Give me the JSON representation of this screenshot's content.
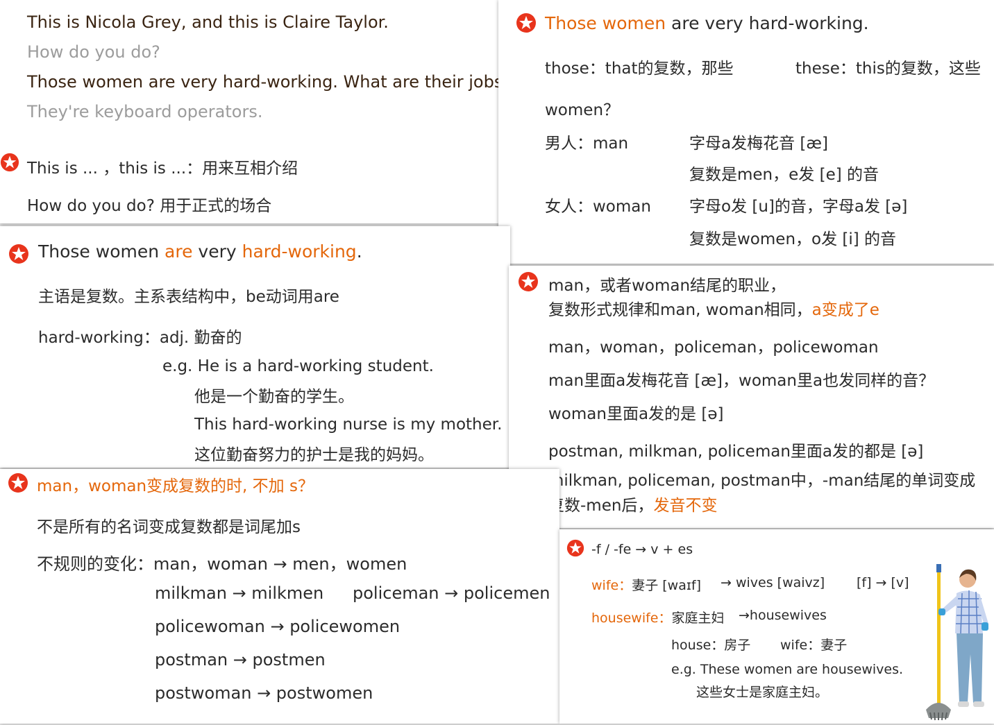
{
  "colors": {
    "accent": "#e4670b",
    "star": "#e8341c",
    "dark_text": "#3a2412",
    "muted_text": "#9c9c9c"
  },
  "p1": {
    "line1": "This is Nicola Grey, and this is Claire Taylor.",
    "line2": "How do you do?",
    "line3": "Those women are very hard-working. What are their jobs?",
    "line4": "They're keyboard operators.",
    "note1": "This is ... ，this is ...：用来互相介绍",
    "note2": "How do you do? 用于正式的场合"
  },
  "p2": {
    "head_a": "Those women",
    "head_b": " are very hard-working.",
    "those": "those：that的复数，那些",
    "these": "these：this的复数，这些",
    "women_q": "women？",
    "man_label": "男人：man",
    "man_desc1": "字母a发梅花音 [æ]",
    "man_desc2": "复数是men，e发 [e] 的音",
    "woman_label": "女人：woman",
    "woman_desc1": "字母o发 [u]的音，字母a发 [ə]",
    "woman_desc2": "复数是women，o发 [i] 的音"
  },
  "p3": {
    "h1": "Those women ",
    "h2": "are",
    " h3": "",
    "h3a": " very ",
    "h4": "hard-working",
    "h5": ".",
    "l1": "主语是复数。主系表结构中，be动词用are",
    "l2": "hard-working：adj. 勤奋的",
    "eg1": "e.g. He is a hard-working student.",
    "eg1_cn": "他是一个勤奋的学生。",
    "eg2": "This hard-working nurse is my mother.",
    "eg2_cn": "这位勤奋努力的护士是我的妈妈。"
  },
  "p4": {
    "h1": "man，或者woman结尾的职业，",
    "h2a": "复数形式规律和man, woman相同，",
    "h2b": "a变成了e",
    "l1": "man，woman，policeman，policewoman",
    "l2": "man里面a发梅花音 [æ]，woman里a也发同样的音？",
    "l3": "woman里面a发的是 [ə]",
    "l4": "postman, milkman, policeman里面a发的都是 [ə]",
    "l5": "milkman, policeman, postman中，-man结尾的单词变成",
    "l6a": "复数-men后，",
    "l6b": "发音不变"
  },
  "p5": {
    "h": "man，woman变成复数的时, 不加 s？",
    "l1": "不是所有的名词变成复数都是词尾加s",
    "l2": "不规则的变化：man，woman → men，women",
    "l3a": "milkman → milkmen",
    "l3b": "policeman → policemen",
    "l4": "policewoman → policewomen",
    "l5": "postman → postmen",
    "l6": "postwoman → postwomen"
  },
  "p6": {
    "h": "-f / -fe → v + es",
    "wife_a": "wife：",
    "wife_b": "妻子 [waɪf]",
    "wives": "→ wives [waivz]",
    "fv": "[f] → [v]",
    "hw_a": "housewife：",
    "hw_b": "家庭主妇",
    "hws": "→housewives",
    "house": "house：房子",
    "wife2": "wife：妻子",
    "eg": "e.g. These women are housewives.",
    "eg_cn": "这些女士是家庭主妇。"
  },
  "icons": {
    "bullet": "star-badge-icon",
    "figure": "housewife-with-mop-illustration"
  }
}
